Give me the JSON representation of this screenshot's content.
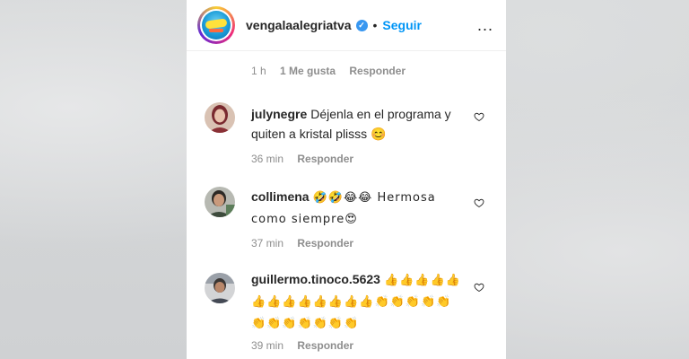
{
  "post": {
    "username": "vengalaalegriatva",
    "verified_icon": "verified-badge-icon",
    "separator": "•",
    "follow_label": "Seguir",
    "more_label": "..."
  },
  "caption_meta": {
    "time": "1 h",
    "likes": "1 Me gusta",
    "reply": "Responder"
  },
  "comments": [
    {
      "user": "julynegre",
      "text": "Déjenla en el programa y quiten a kristal plisss 😊",
      "time": "36 min",
      "reply": "Responder"
    },
    {
      "user": "collimena",
      "text": "🤣🤣😂😂 Hermosa como siempre😍",
      "time": "37 min",
      "reply": "Responder"
    },
    {
      "user": "guillermo.tinoco.5623",
      "text": "👍👍👍👍👍👍👍👍👍👍👍👍👍👏👏👏👏👏👏👏👏👏👏👏👏",
      "time": "39 min",
      "reply": "Responder"
    }
  ],
  "colors": {
    "accent": "#0095f6",
    "verified": "#3897f0",
    "muted": "#8e8e8e",
    "text": "#262626"
  }
}
